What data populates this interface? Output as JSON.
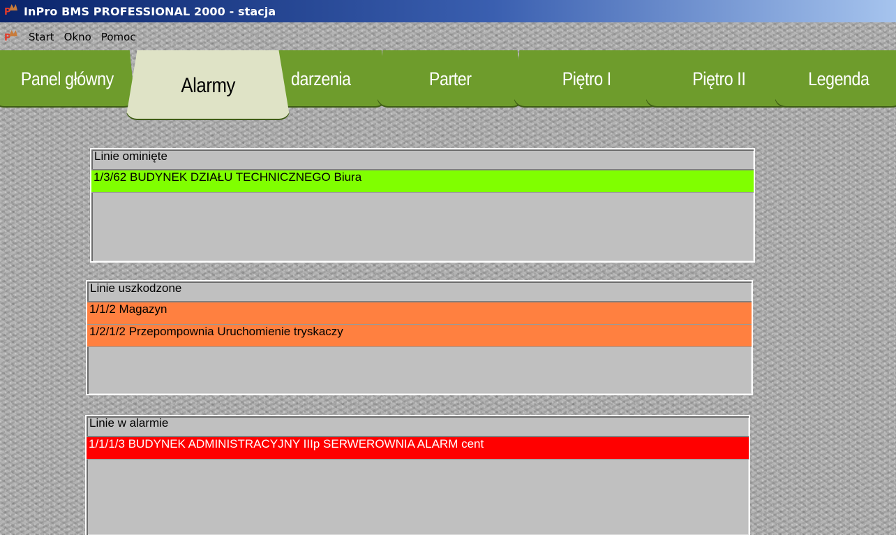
{
  "window": {
    "title": "InPro BMS PROFESSIONAL 2000 - stacja",
    "icon": "inpro-app-icon"
  },
  "menu": {
    "items": [
      "Start",
      "Okno",
      "Pomoc"
    ]
  },
  "tabs": [
    {
      "label": "Panel główny",
      "active": false
    },
    {
      "label": "Alarmy",
      "active": true
    },
    {
      "label": "darzenia",
      "active": false
    },
    {
      "label": "Parter",
      "active": false
    },
    {
      "label": "Piętro I",
      "active": false
    },
    {
      "label": "Piętro II",
      "active": false
    },
    {
      "label": "Legenda",
      "active": false
    }
  ],
  "panels": {
    "bypassed": {
      "header": "Linie ominięte",
      "rows": [
        "1/3/62 BUDYNEK DZIAŁU TECHNICZNEGO Biura"
      ]
    },
    "faulty": {
      "header": "Linie uszkodzone",
      "rows": [
        "1/1/2 Magazyn",
        "1/2/1/2 Przepompownia Uruchomienie tryskaczy"
      ]
    },
    "alarm": {
      "header": "Linie w alarmie",
      "rows": [
        "1/1/1/3 BUDYNEK ADMINISTRACYJNY IIIp SERWEROWNIA  ALARM cent"
      ]
    }
  },
  "colors": {
    "tab_green": "#6e9c2c",
    "tab_active": "#dfe3c6",
    "row_bypassed": "#80ff00",
    "row_faulty": "#ff8040",
    "row_alarm": "#ff0000",
    "panel_bg": "#c0c0c0"
  }
}
